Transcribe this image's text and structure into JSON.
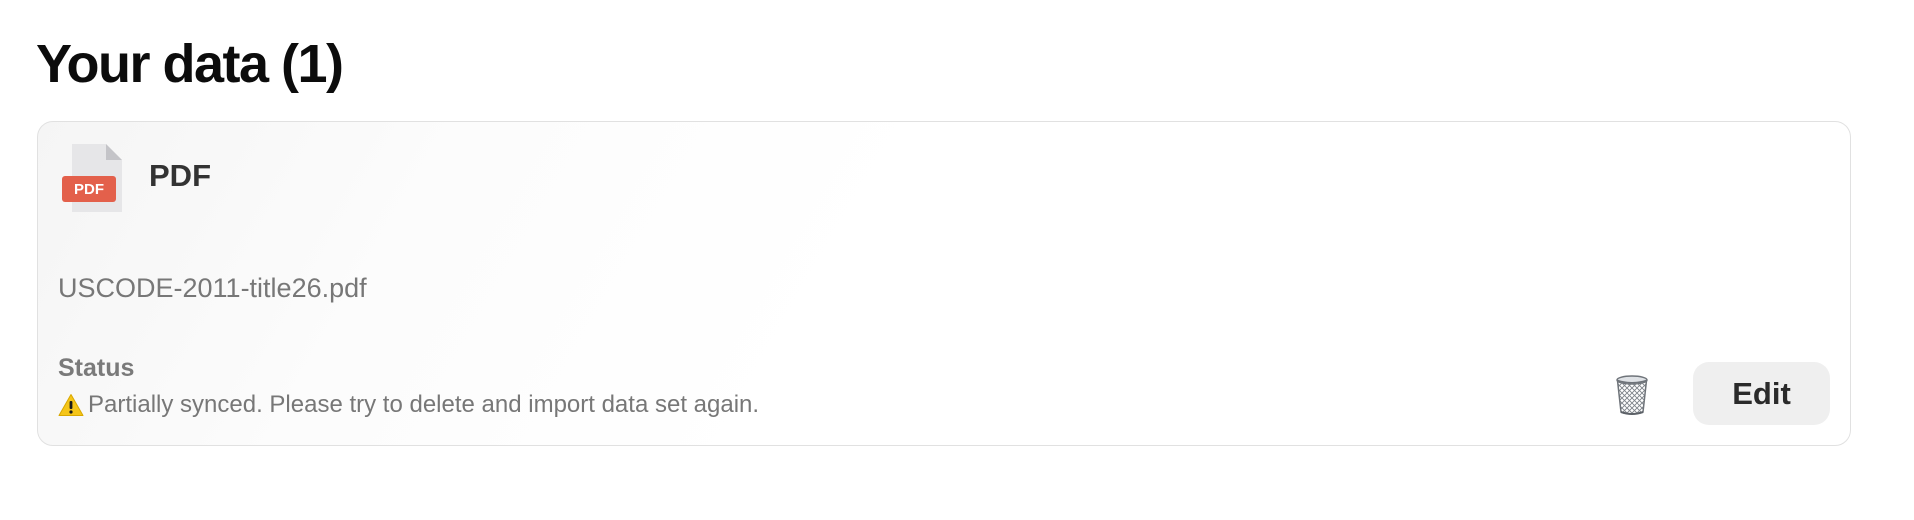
{
  "page": {
    "title": "Your data (1)"
  },
  "dataset": {
    "file_type": "PDF",
    "file_badge": "PDF",
    "file_name": "USCODE-2011-title26.pdf",
    "status_label": "Status",
    "status_message": "Partially synced. Please try to delete and import data set again.",
    "status_icon": "warning-icon",
    "delete_icon": "trash-icon",
    "edit_label": "Edit"
  },
  "colors": {
    "badge_red": "#e3604b",
    "warning_yellow": "#f5c518"
  }
}
